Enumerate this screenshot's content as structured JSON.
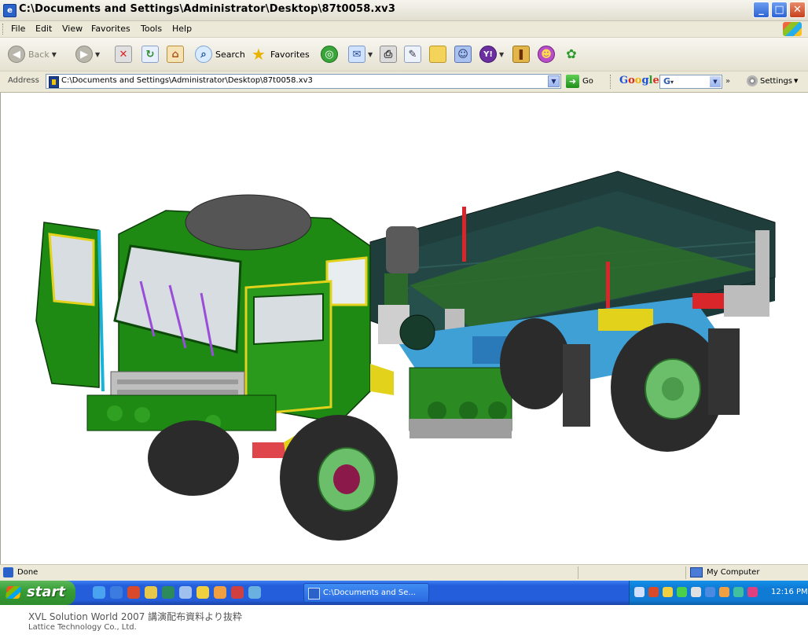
{
  "window": {
    "title": "C:\\Documents and Settings\\Administrator\\Desktop\\87t0058.xv3",
    "controls": {
      "minimize": "_",
      "maximize": "□",
      "close": "✕"
    }
  },
  "menubar": {
    "items": [
      "File",
      "Edit",
      "View",
      "Favorites",
      "Tools",
      "Help"
    ]
  },
  "toolbar": {
    "back_label": "Back",
    "search_label": "Search",
    "favorites_label": "Favorites",
    "icons": [
      "back-icon",
      "forward-icon",
      "stop-icon",
      "refresh-icon",
      "home-icon",
      "search-icon",
      "favorites-star-icon",
      "media-icon",
      "mail-icon",
      "print-icon",
      "edit-icon",
      "folder-icon",
      "messenger-icon",
      "yahoo-icon",
      "bookmark-icon",
      "msn-icon",
      "butterfly-icon"
    ]
  },
  "address": {
    "label": "Address",
    "url": "C:\\Documents and Settings\\Administrator\\Desktop\\87t0058.xv3",
    "go_label": "Go"
  },
  "google": {
    "logo": "Google",
    "search_value": "G",
    "more": "»",
    "settings_label": "Settings"
  },
  "content": {
    "image_subject": "3D truck model",
    "colors": {
      "cab": "#1e8a14",
      "cargo_bed": "#1f3d3b",
      "tire": "#2b2b2b",
      "rim": "#6bbf6a",
      "accent_yellow": "#e2d21c",
      "accent_red": "#d8262b"
    }
  },
  "status": {
    "text": "Done",
    "zone": "My Computer"
  },
  "taskbar": {
    "start_label": "start",
    "task_label": "C:\\Documents and Se...",
    "clock": "12:16 PM"
  },
  "caption": {
    "line1": "XVL Solution World 2007 講演配布資料より抜粋",
    "line2": "Lattice Technology Co., Ltd."
  }
}
